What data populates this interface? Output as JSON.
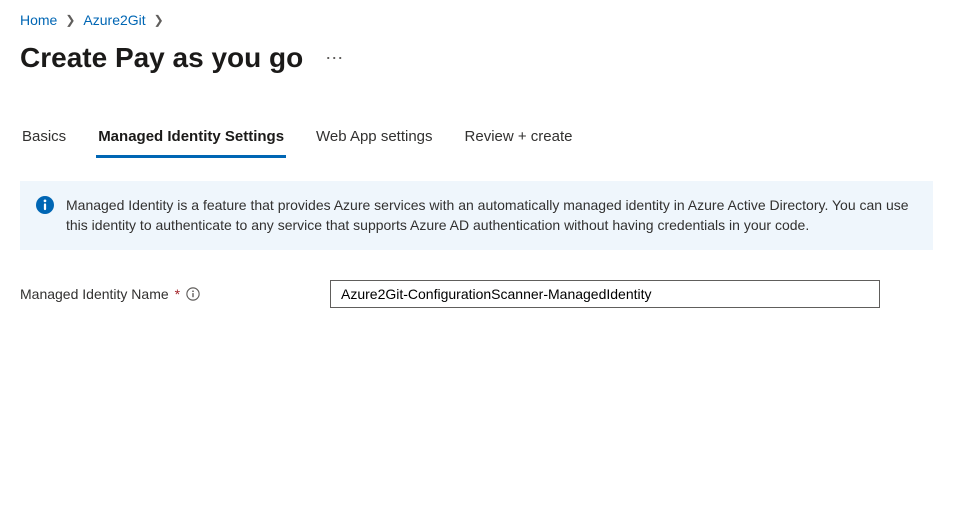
{
  "breadcrumb": {
    "items": [
      {
        "label": "Home"
      },
      {
        "label": "Azure2Git"
      }
    ]
  },
  "header": {
    "title": "Create Pay as you go"
  },
  "tabs": [
    {
      "label": "Basics",
      "active": false
    },
    {
      "label": "Managed Identity Settings",
      "active": true
    },
    {
      "label": "Web App settings",
      "active": false
    },
    {
      "label": "Review + create",
      "active": false
    }
  ],
  "info": {
    "text": "Managed Identity is a feature that provides Azure services with an automatically managed identity in Azure Active Directory. You can use this identity to authenticate to any service that supports Azure AD authentication without having credentials in your code."
  },
  "form": {
    "managedIdentityName": {
      "label": "Managed Identity Name",
      "value": "Azure2Git-ConfigurationScanner-ManagedIdentity"
    }
  }
}
